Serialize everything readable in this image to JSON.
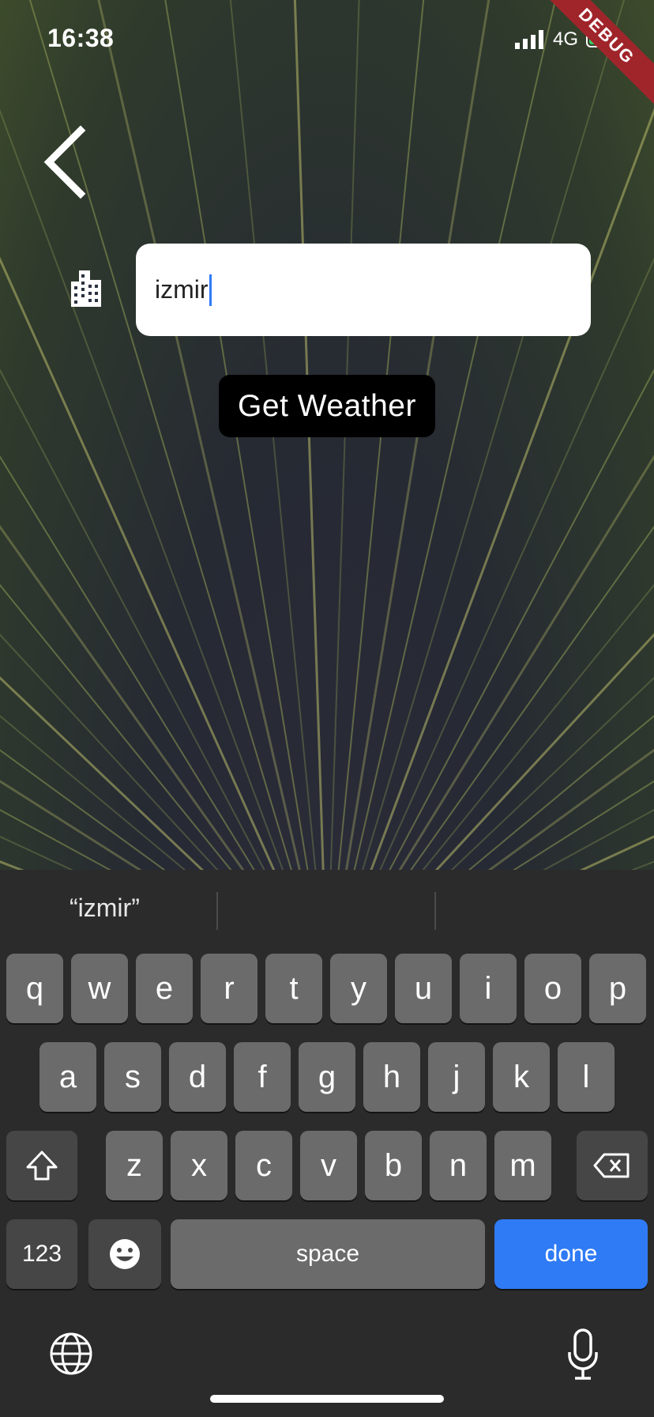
{
  "status_bar": {
    "time": "16:38",
    "network": "4G",
    "debug_banner": "DEBUG"
  },
  "search": {
    "value": "izmir",
    "button_label": "Get Weather"
  },
  "keyboard": {
    "suggestions": [
      "“izmir”",
      "",
      ""
    ],
    "row1": [
      "q",
      "w",
      "e",
      "r",
      "t",
      "y",
      "u",
      "i",
      "o",
      "p"
    ],
    "row2": [
      "a",
      "s",
      "d",
      "f",
      "g",
      "h",
      "j",
      "k",
      "l"
    ],
    "row3": [
      "z",
      "x",
      "c",
      "v",
      "b",
      "n",
      "m"
    ],
    "numbers_label": "123",
    "space_label": "space",
    "done_label": "done"
  },
  "icons": [
    "back-arrow-icon",
    "city-building-icon",
    "shift-icon",
    "delete-icon",
    "emoji-icon",
    "globe-icon",
    "microphone-icon"
  ],
  "colors": {
    "accent": "#2f7bf6",
    "button": "#000000",
    "keyboard": "#2b2b2b",
    "debug": "#a0252b"
  }
}
